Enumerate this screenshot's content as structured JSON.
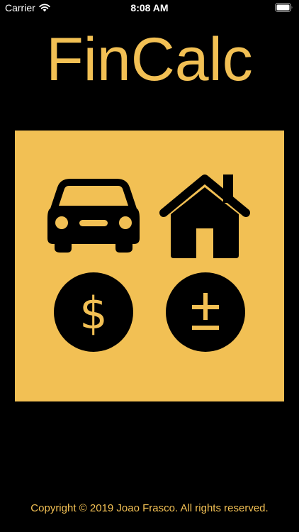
{
  "status_bar": {
    "carrier": "Carrier",
    "time": "8:08 AM"
  },
  "app": {
    "title": "FinCalc"
  },
  "menu": {
    "items": [
      {
        "icon": "car-icon"
      },
      {
        "icon": "house-icon"
      },
      {
        "icon": "dollar-icon"
      },
      {
        "icon": "plus-minus-icon"
      }
    ]
  },
  "footer": {
    "copyright": "Copyright © 2019 Joao Frasco. All rights reserved."
  },
  "colors": {
    "background": "#000000",
    "accent": "#F2C054",
    "icon": "#000000",
    "status_text": "#FFFFFF"
  }
}
